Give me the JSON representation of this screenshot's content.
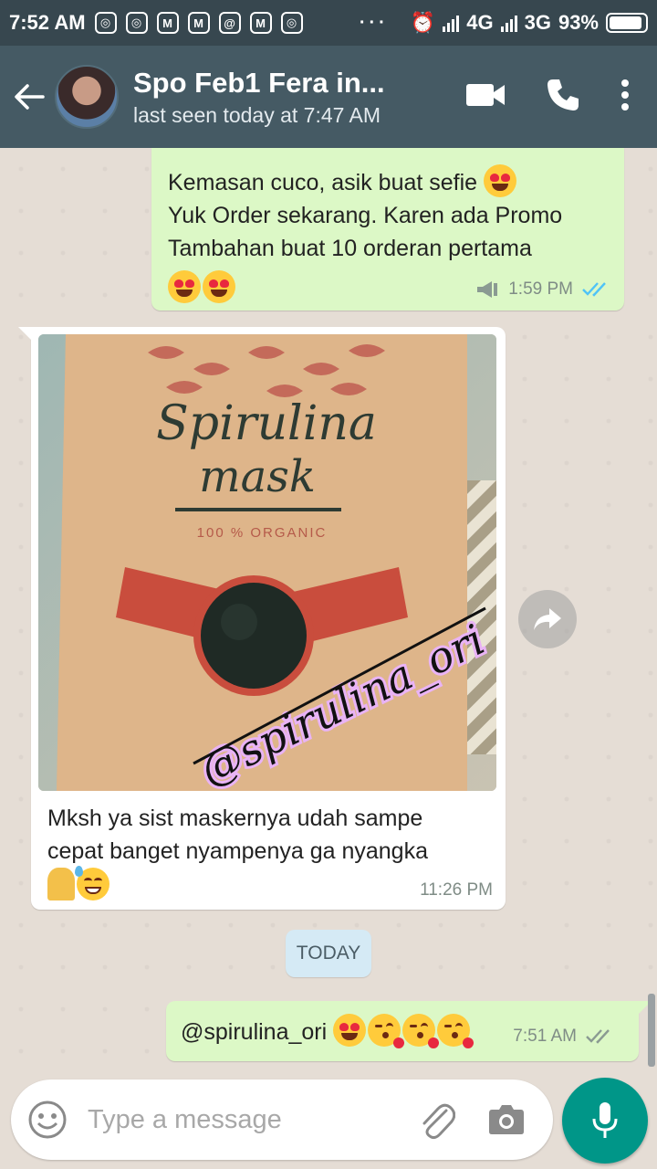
{
  "status_bar": {
    "time": "7:52 AM",
    "network_1": "4G",
    "network_2": "3G",
    "battery": "93%",
    "battery_level": 0.93
  },
  "header": {
    "contact_name": "Spo Feb1 Fera in...",
    "last_seen": "last seen today at 7:47 AM"
  },
  "messages": [
    {
      "direction": "outgoing",
      "lines": [
        "Kemasan cuco, asik buat sefie",
        "Yuk Order sekarang. Karen ada Promo",
        "Tambahan buat 10 orderan pertama"
      ],
      "time": "1:59 PM",
      "status": "read"
    },
    {
      "direction": "incoming",
      "image": {
        "brand_line1": "Spirulina",
        "brand_line2": "mask",
        "tagline": "100 % ORGANIC",
        "watermark": "@spirulina_ori"
      },
      "lines": [
        "Mksh ya sist maskernya udah sampe",
        "cepat banget nyampenya ga nyangka"
      ],
      "time": "11:26 PM"
    },
    {
      "direction": "outgoing",
      "text": "@spirulina_ori",
      "time": "7:51 AM",
      "status": "delivered"
    }
  ],
  "date_separator": "TODAY",
  "composer": {
    "placeholder": "Type a message"
  },
  "colors": {
    "app_bar": "#455a64",
    "status_bar": "#37474f",
    "outgoing_bubble": "#dcf8c6",
    "incoming_bubble": "#ffffff",
    "mic_button": "#009688",
    "read_ticks": "#4fc3f7"
  }
}
